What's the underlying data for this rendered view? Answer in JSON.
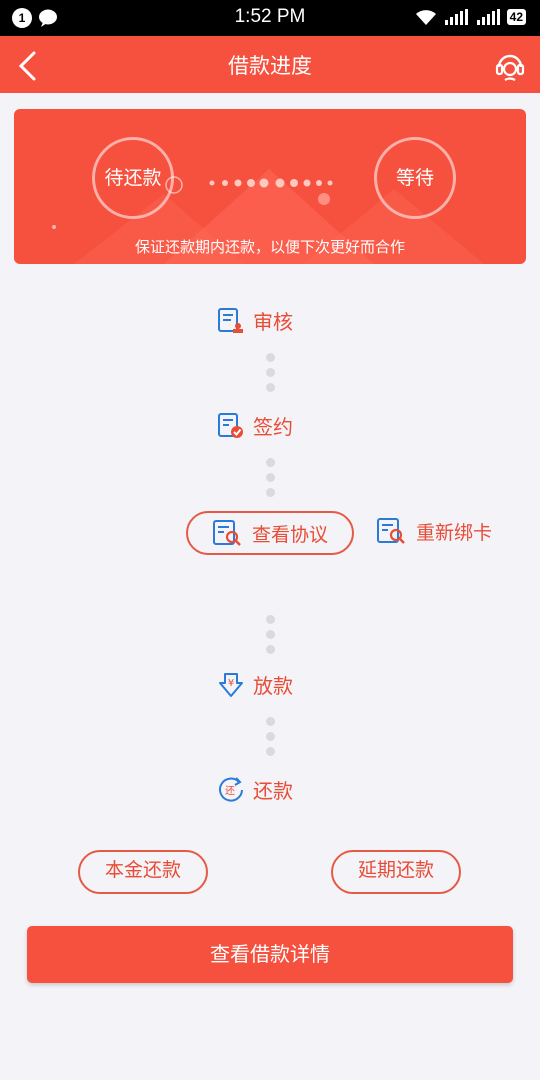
{
  "status_bar": {
    "time": "1:52 PM",
    "notification_count": "1",
    "battery": "42"
  },
  "header": {
    "title": "借款进度"
  },
  "banner": {
    "current_status": "待还款",
    "next_status": "等待",
    "hint": "保证还款期内还款，以便下次更好而合作"
  },
  "steps": [
    {
      "label": "审核"
    },
    {
      "label": "签约"
    },
    {
      "label": "放款"
    },
    {
      "label": "还款"
    }
  ],
  "actions": {
    "view_agreement": "查看协议",
    "rebind_card": "重新绑卡",
    "principal_repay": "本金还款",
    "extend_repay": "延期还款",
    "view_detail": "查看借款详情"
  },
  "colors": {
    "brand": "#f5513e",
    "text_accent": "#e84d36",
    "icon_blue": "#2a7bd8"
  }
}
